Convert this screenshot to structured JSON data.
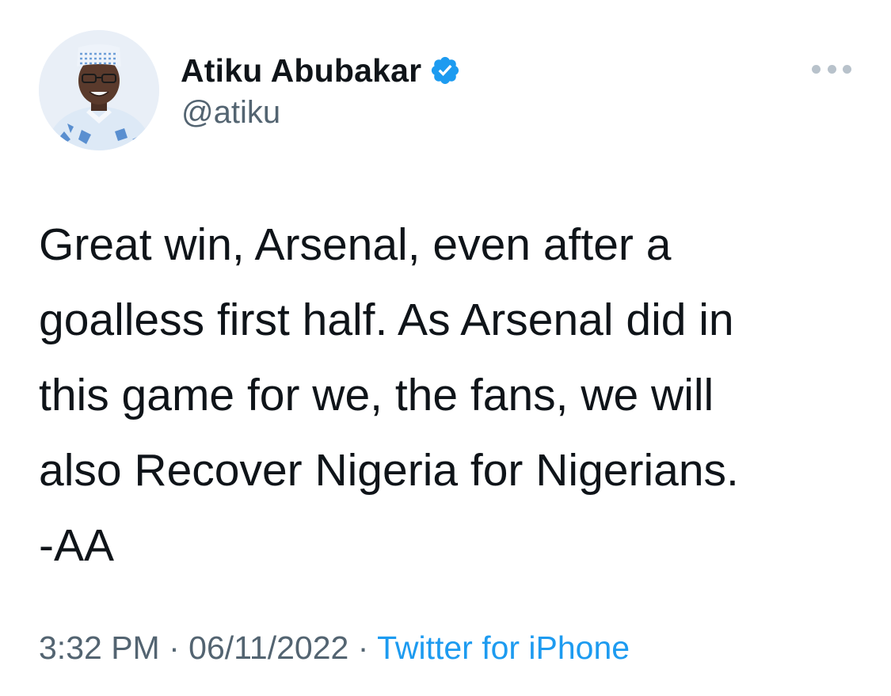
{
  "user": {
    "display_name": "Atiku Abubakar",
    "handle": "@atiku",
    "verified": true
  },
  "tweet": {
    "lines": [
      "Great win, Arsenal, even after a",
      "goalless first half. As Arsenal did in",
      "this game for we, the fans, we will",
      "also Recover Nigeria for Nigerians.",
      "-AA"
    ]
  },
  "meta": {
    "time": "3:32 PM",
    "separator": "·",
    "date": "06/11/2022",
    "source": "Twitter for iPhone"
  },
  "icons": {
    "verified": "verified-badge-icon",
    "more": "more-options-icon"
  },
  "colors": {
    "text": "#0f1419",
    "secondary": "#536471",
    "accent": "#1d9bf0",
    "background": "#ffffff"
  }
}
